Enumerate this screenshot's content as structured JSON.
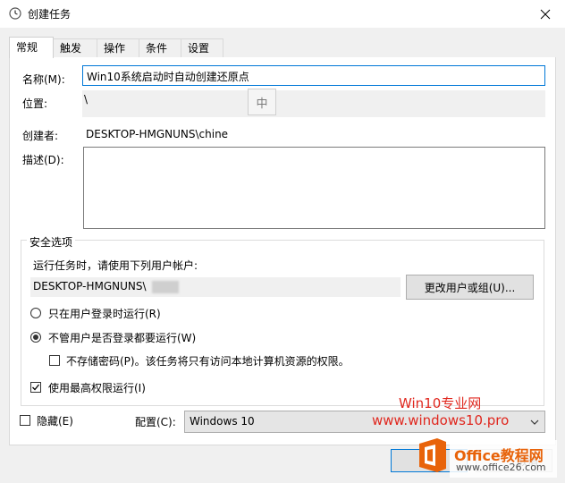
{
  "window": {
    "title": "创建任务"
  },
  "tabs": [
    {
      "label": "常规"
    },
    {
      "label": "触发器"
    },
    {
      "label": "操作"
    },
    {
      "label": "条件"
    },
    {
      "label": "设置"
    }
  ],
  "general": {
    "name_label": "名称(M):",
    "name_value": "Win10系统启动时自动创建还原点",
    "location_label": "位置:",
    "location_value": "\\",
    "author_label": "创建者:",
    "author_value": "DESKTOP-HMGNUNS\\chine",
    "description_label": "描述(D):",
    "description_value": "",
    "ime_indicator": "中"
  },
  "security": {
    "group_title": "安全选项",
    "run_as_label": "运行任务时，请使用下列用户帐户:",
    "user_account": "DESKTOP-HMGNUNS\\",
    "change_user_button": "更改用户或组(U)...",
    "radio_logged_on_only": "只在用户登录时运行(R)",
    "radio_whether_logged_on": "不管用户是否登录都要运行(W)",
    "radio_selected": "whether_logged_on",
    "no_store_password": "不存储密码(P)。该任务将只有访问本地计算机资源的权限。",
    "no_store_password_checked": false,
    "highest_privileges": "使用最高权限运行(I)",
    "highest_privileges_checked": true
  },
  "footer": {
    "hidden_label": "隐藏(E)",
    "hidden_checked": false,
    "configure_label": "配置(C):",
    "configure_value": "Windows 10",
    "ok_partial": "确",
    "cancel_partial": "取消"
  },
  "watermark": {
    "line1": "Win10专业网",
    "line2": "www.windows10.pro",
    "brand": "Office教程网",
    "url": "www.office26.com"
  },
  "colors": {
    "accent_focus": "#0078d7",
    "watermark_red": "#e0281f",
    "office_orange": "#e8630a"
  }
}
